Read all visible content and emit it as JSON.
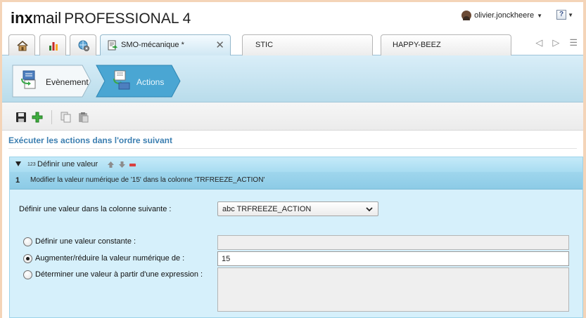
{
  "app": {
    "brand_bold": "inx",
    "brand_light": "mail",
    "product": "PROFESSIONAL 4"
  },
  "user": {
    "name": "olivier.jonckheere"
  },
  "help": {
    "symbol": "?"
  },
  "tabs": [
    {
      "label": "SMO-mécanique *",
      "active": true
    },
    {
      "label": "STIC",
      "active": false
    },
    {
      "label": "HAPPY-BEEZ",
      "active": false
    }
  ],
  "icon_tabs": [
    "home-icon",
    "reports-icon",
    "settings-globe-icon"
  ],
  "wizard": {
    "steps": [
      {
        "label": "Evènement",
        "active": false
      },
      {
        "label": "Actions",
        "active": true
      }
    ]
  },
  "toolbar": {
    "icons": [
      "save-icon",
      "add-icon",
      "copy-icon",
      "paste-icon"
    ]
  },
  "section": {
    "title": "Exécuter les actions dans l'ordre suivant"
  },
  "action": {
    "type_badge": "123",
    "title": "Définir une valeur",
    "index": "1",
    "description": "Modifier la valeur numérique de '15' dans la colonne 'TRFREEZE_ACTION'",
    "column_label": "Définir une valeur dans la colonne suivante :",
    "column_value": "abc TRFREEZE_ACTION",
    "options": [
      {
        "label": "Définir une valeur constante :",
        "selected": false,
        "value": ""
      },
      {
        "label": "Augmenter/réduire la valeur numérique de :",
        "selected": true,
        "value": "15"
      },
      {
        "label": "Déterminer une valeur à partir d'une expression :",
        "selected": false,
        "value": ""
      }
    ]
  },
  "colors": {
    "accent_title": "#3c7fb1",
    "panel_bg": "#d6f0fb",
    "panel_head": "#a8dcf1",
    "wizard_active": "#4aa6d3",
    "delete_red": "#d94040"
  }
}
